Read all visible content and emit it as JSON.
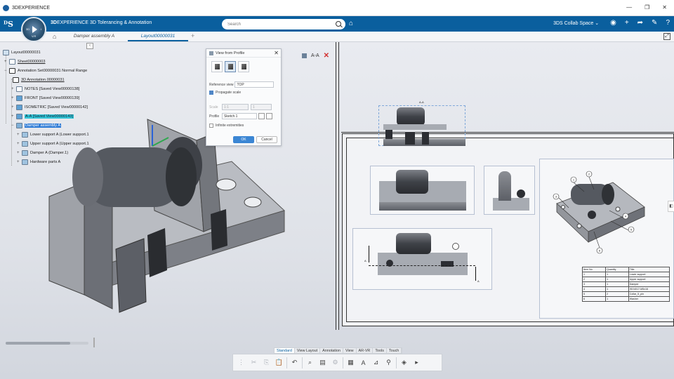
{
  "os": {
    "title": "3DEXPERIENCE"
  },
  "header": {
    "brand": "3D",
    "app_prefix": "3D",
    "app_title": "EXPERIENCE 3D Tolerancing & Annotation",
    "compass_version": "V.R",
    "search_placeholder": "Search",
    "collab_space": "3DS Collab Space"
  },
  "tabs": [
    {
      "label": "Damper assembly A"
    },
    {
      "label": "Layout00000031"
    }
  ],
  "tree": {
    "root": "Layout00000031",
    "sheet": "Sheet00000003",
    "annotation_set": "Annotation Set00000031 Normal Range",
    "items": [
      {
        "label": "3D Annotation.00000031"
      },
      {
        "label": "NOTES [Saved View00000138]"
      },
      {
        "label": "FRONT [Saved View00000139]"
      },
      {
        "label": "ISOMETRIC [Saved View00000142]"
      },
      {
        "label": "A-A [Saved View00000143]"
      },
      {
        "label": "Damper assembly A"
      },
      {
        "label": "Lower support A (Lower support.1"
      },
      {
        "label": "Upper support A (Upper support.1"
      },
      {
        "label": "Damper A (Damper.1)"
      },
      {
        "label": "Hardware parts A"
      }
    ]
  },
  "dialog": {
    "title": "View from Profile",
    "reference_view_label": "Reference view",
    "reference_view_value": "TOP",
    "propagate_scale_label": "Propagate scale",
    "scale_label": "Scale",
    "scale_value": "1:1",
    "scale_value2": "1",
    "profile_label": "Profile",
    "profile_value": "Sketch.1",
    "infinite_label": "Infinite extremities",
    "ok": "OK",
    "cancel": "Cancel"
  },
  "section_label": "A-A",
  "drawing": {
    "section_tag": "A-A",
    "cut_a1": "A",
    "cut_a2": "A",
    "balloons": [
      "1",
      "2",
      "3",
      "4",
      "5",
      "6"
    ],
    "bom_headers": [
      "Item No.",
      "Quantity",
      "Title"
    ],
    "bom_rows": [
      [
        "1",
        "1",
        "Lower support"
      ],
      [
        "2",
        "1",
        "Upper support"
      ],
      [
        "3",
        "1",
        "Damper"
      ],
      [
        "4",
        "1",
        "ISO4017-M5x16"
      ],
      [
        "5",
        "2",
        "Collar_5_pin"
      ],
      [
        "6",
        "1",
        "Washer"
      ]
    ]
  },
  "bottom_tabs": [
    "Standard",
    "View Layout",
    "Annotation",
    "View",
    "AR-VR",
    "Tools",
    "Touch"
  ],
  "action_icons": [
    "cut-icon",
    "copy-icon",
    "paste-icon",
    "undo-icon",
    "zoom-icon",
    "book-icon",
    "settings-icon",
    "measure-icon",
    "text-icon",
    "datum-icon",
    "probe-icon",
    "view-icon"
  ],
  "colors": {
    "brand": "#0a5f9e",
    "selected": "#2e7bd6",
    "highlight": "#33c6d8",
    "close_red": "#d23030"
  }
}
